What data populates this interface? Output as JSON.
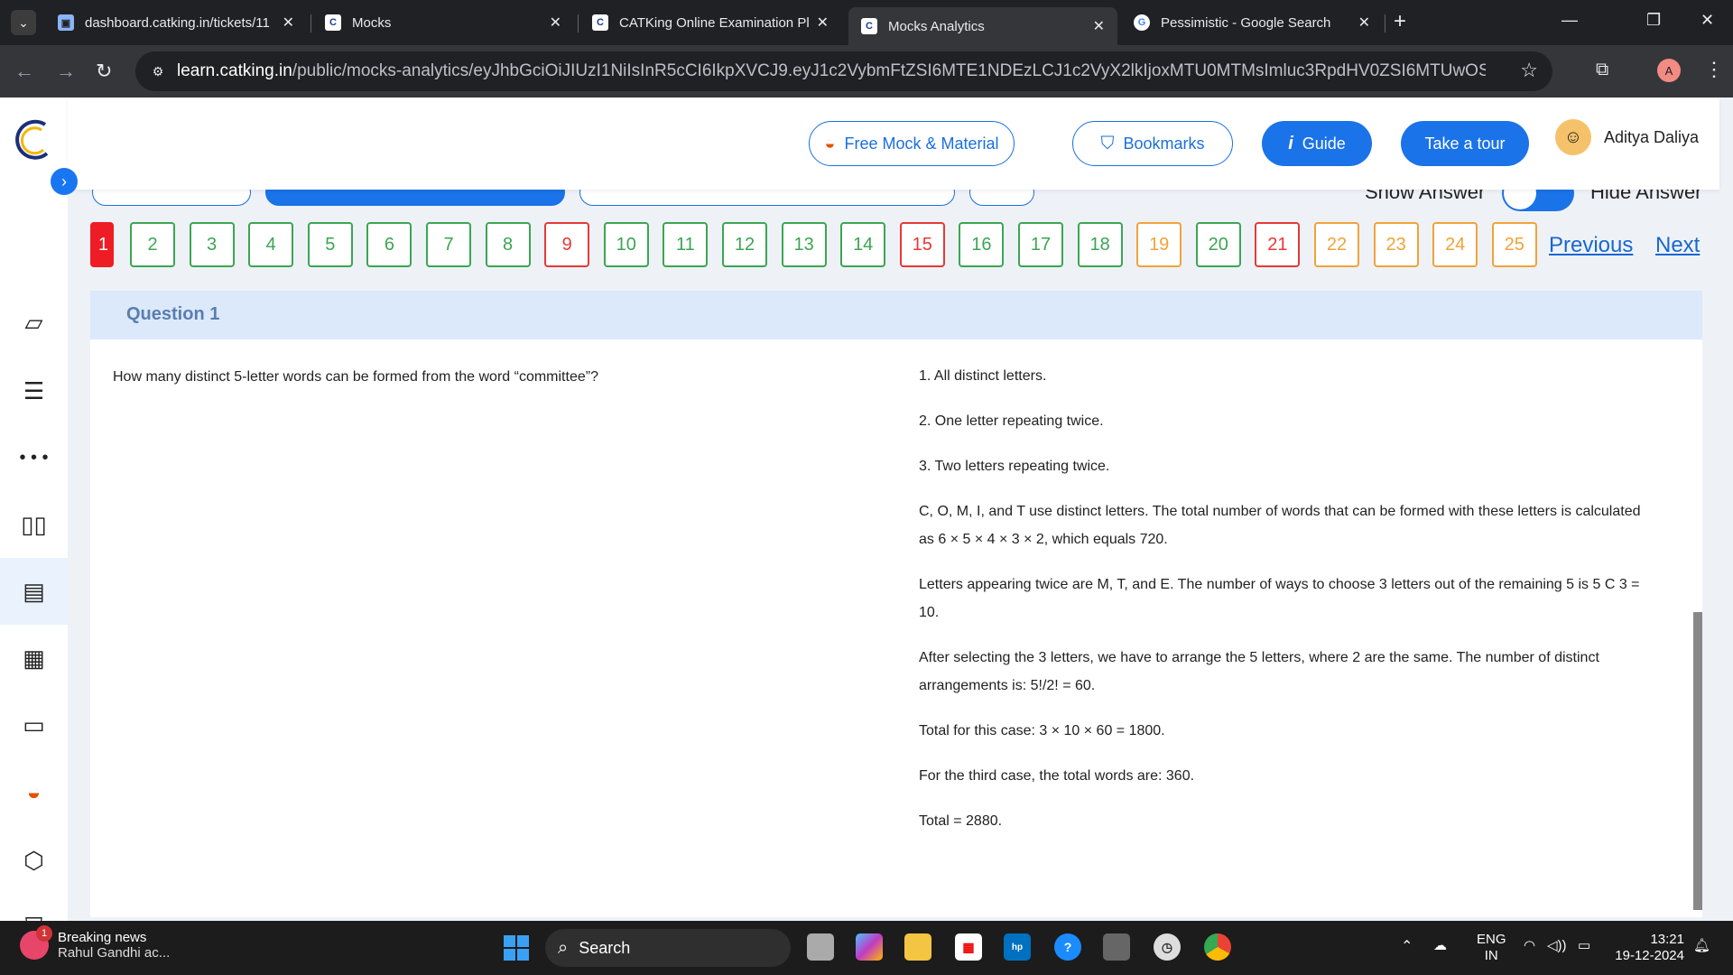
{
  "browser": {
    "tabs": [
      {
        "title": "dashboard.catking.in/tickets/11",
        "favicon": "page-icon"
      },
      {
        "title": "Mocks",
        "favicon": "catking-logo-icon"
      },
      {
        "title": "CATKing Online Examination Pl",
        "favicon": "catking-logo-icon"
      },
      {
        "title": "Mocks Analytics",
        "favicon": "catking-logo-icon"
      },
      {
        "title": "Pessimistic - Google Search",
        "favicon": "google-icon"
      }
    ],
    "url_host": "learn.catking.in",
    "url_path": "/public/mocks-analytics/eyJhbGciOiJIUzI1NiIsInR5cCI6IkpXVCJ9.eyJ1c2VybmFtZSI6MTE1NDEzLCJ1c2VyX2lkIjoxMTU0MTMsImluc3RpdHV0ZSI6MTUwOSwiaWQiOjExNTQxMywiZX...",
    "profile_initial": "A"
  },
  "header": {
    "free_mock": "Free Mock & Material",
    "bookmarks": "Bookmarks",
    "guide": "Guide",
    "tour": "Take a tour",
    "user_name": "Aditya Daliya",
    "show_answer": "Show Answer",
    "hide_answer": "Hide Answer"
  },
  "question_nav": {
    "current": "1",
    "numbers": [
      {
        "n": "2",
        "status": "green"
      },
      {
        "n": "3",
        "status": "green"
      },
      {
        "n": "4",
        "status": "green"
      },
      {
        "n": "5",
        "status": "green"
      },
      {
        "n": "6",
        "status": "green"
      },
      {
        "n": "7",
        "status": "green"
      },
      {
        "n": "8",
        "status": "green"
      },
      {
        "n": "9",
        "status": "red"
      },
      {
        "n": "10",
        "status": "green"
      },
      {
        "n": "11",
        "status": "green"
      },
      {
        "n": "12",
        "status": "green"
      },
      {
        "n": "13",
        "status": "green"
      },
      {
        "n": "14",
        "status": "green"
      },
      {
        "n": "15",
        "status": "red"
      },
      {
        "n": "16",
        "status": "green"
      },
      {
        "n": "17",
        "status": "green"
      },
      {
        "n": "18",
        "status": "green"
      },
      {
        "n": "19",
        "status": "orange"
      },
      {
        "n": "20",
        "status": "green"
      },
      {
        "n": "21",
        "status": "red"
      },
      {
        "n": "22",
        "status": "orange"
      },
      {
        "n": "23",
        "status": "orange"
      },
      {
        "n": "24",
        "status": "orange"
      },
      {
        "n": "25",
        "status": "orange"
      }
    ],
    "previous": "Previous",
    "next": "Next"
  },
  "question": {
    "title": "Question 1",
    "text": "How many distinct 5-letter words can be formed from the word “committee”?"
  },
  "solution": [
    "1. All distinct letters.",
    "2. One letter repeating twice.",
    "3. Two letters repeating twice.",
    "C, O, M, I, and T use distinct letters. The total number of words that can be formed with these letters is calculated as 6 × 5 × 4 × 3 × 2, which equals 720.",
    "Letters appearing twice are M, T, and E. The number of ways to choose 3 letters out of the remaining 5 is 5 C 3 = 10.",
    "After selecting the 3 letters, we have to arrange the 5 letters, where 2 are the same. The number of distinct arrangements is: 5!/2! = 60.",
    "Total for this case: 3 × 10 × 60 = 1800.",
    "For the third case, the total words are: 360.",
    "Total = 2880."
  ],
  "taskbar": {
    "news_count": "1",
    "news_title": "Breaking news",
    "news_sub": "Rahul Gandhi ac...",
    "search": "Search",
    "lang1": "ENG",
    "lang2": "IN",
    "time": "13:21",
    "date": "19-12-2024"
  },
  "colors": {
    "accent": "#1a73e8",
    "answered": "#3aa651",
    "wrong": "#e53935",
    "skipped": "#f0a33a"
  }
}
